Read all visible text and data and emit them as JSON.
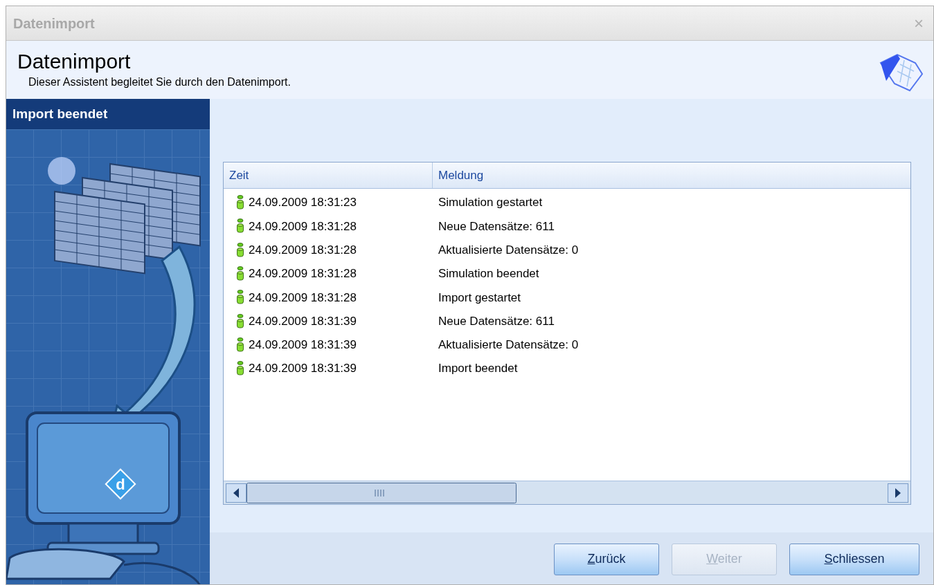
{
  "window": {
    "title": "Datenimport",
    "close": "×"
  },
  "header": {
    "title": "Datenimport",
    "subtitle": "Dieser Assistent begleitet Sie durch den Datenimport."
  },
  "sidebar": {
    "step": "Import beendet",
    "logo_letter": "d"
  },
  "log": {
    "columns": [
      "Zeit",
      "Meldung"
    ],
    "rows": [
      {
        "time": "24.09.2009 18:31:23",
        "message": "Simulation gestartet"
      },
      {
        "time": "24.09.2009 18:31:28",
        "message": "Neue Datensätze: 611"
      },
      {
        "time": "24.09.2009 18:31:28",
        "message": "Aktualisierte Datensätze: 0"
      },
      {
        "time": "24.09.2009 18:31:28",
        "message": "Simulation beendet"
      },
      {
        "time": "24.09.2009 18:31:28",
        "message": "Import gestartet"
      },
      {
        "time": "24.09.2009 18:31:39",
        "message": "Neue Datensätze: 611"
      },
      {
        "time": "24.09.2009 18:31:39",
        "message": "Aktualisierte Datensätze: 0"
      },
      {
        "time": "24.09.2009 18:31:39",
        "message": "Import beendet"
      }
    ]
  },
  "buttons": [
    {
      "label": "Zurück",
      "disabled": false
    },
    {
      "label": "Weiter",
      "disabled": true
    },
    {
      "label": "Schliessen",
      "disabled": false
    }
  ]
}
